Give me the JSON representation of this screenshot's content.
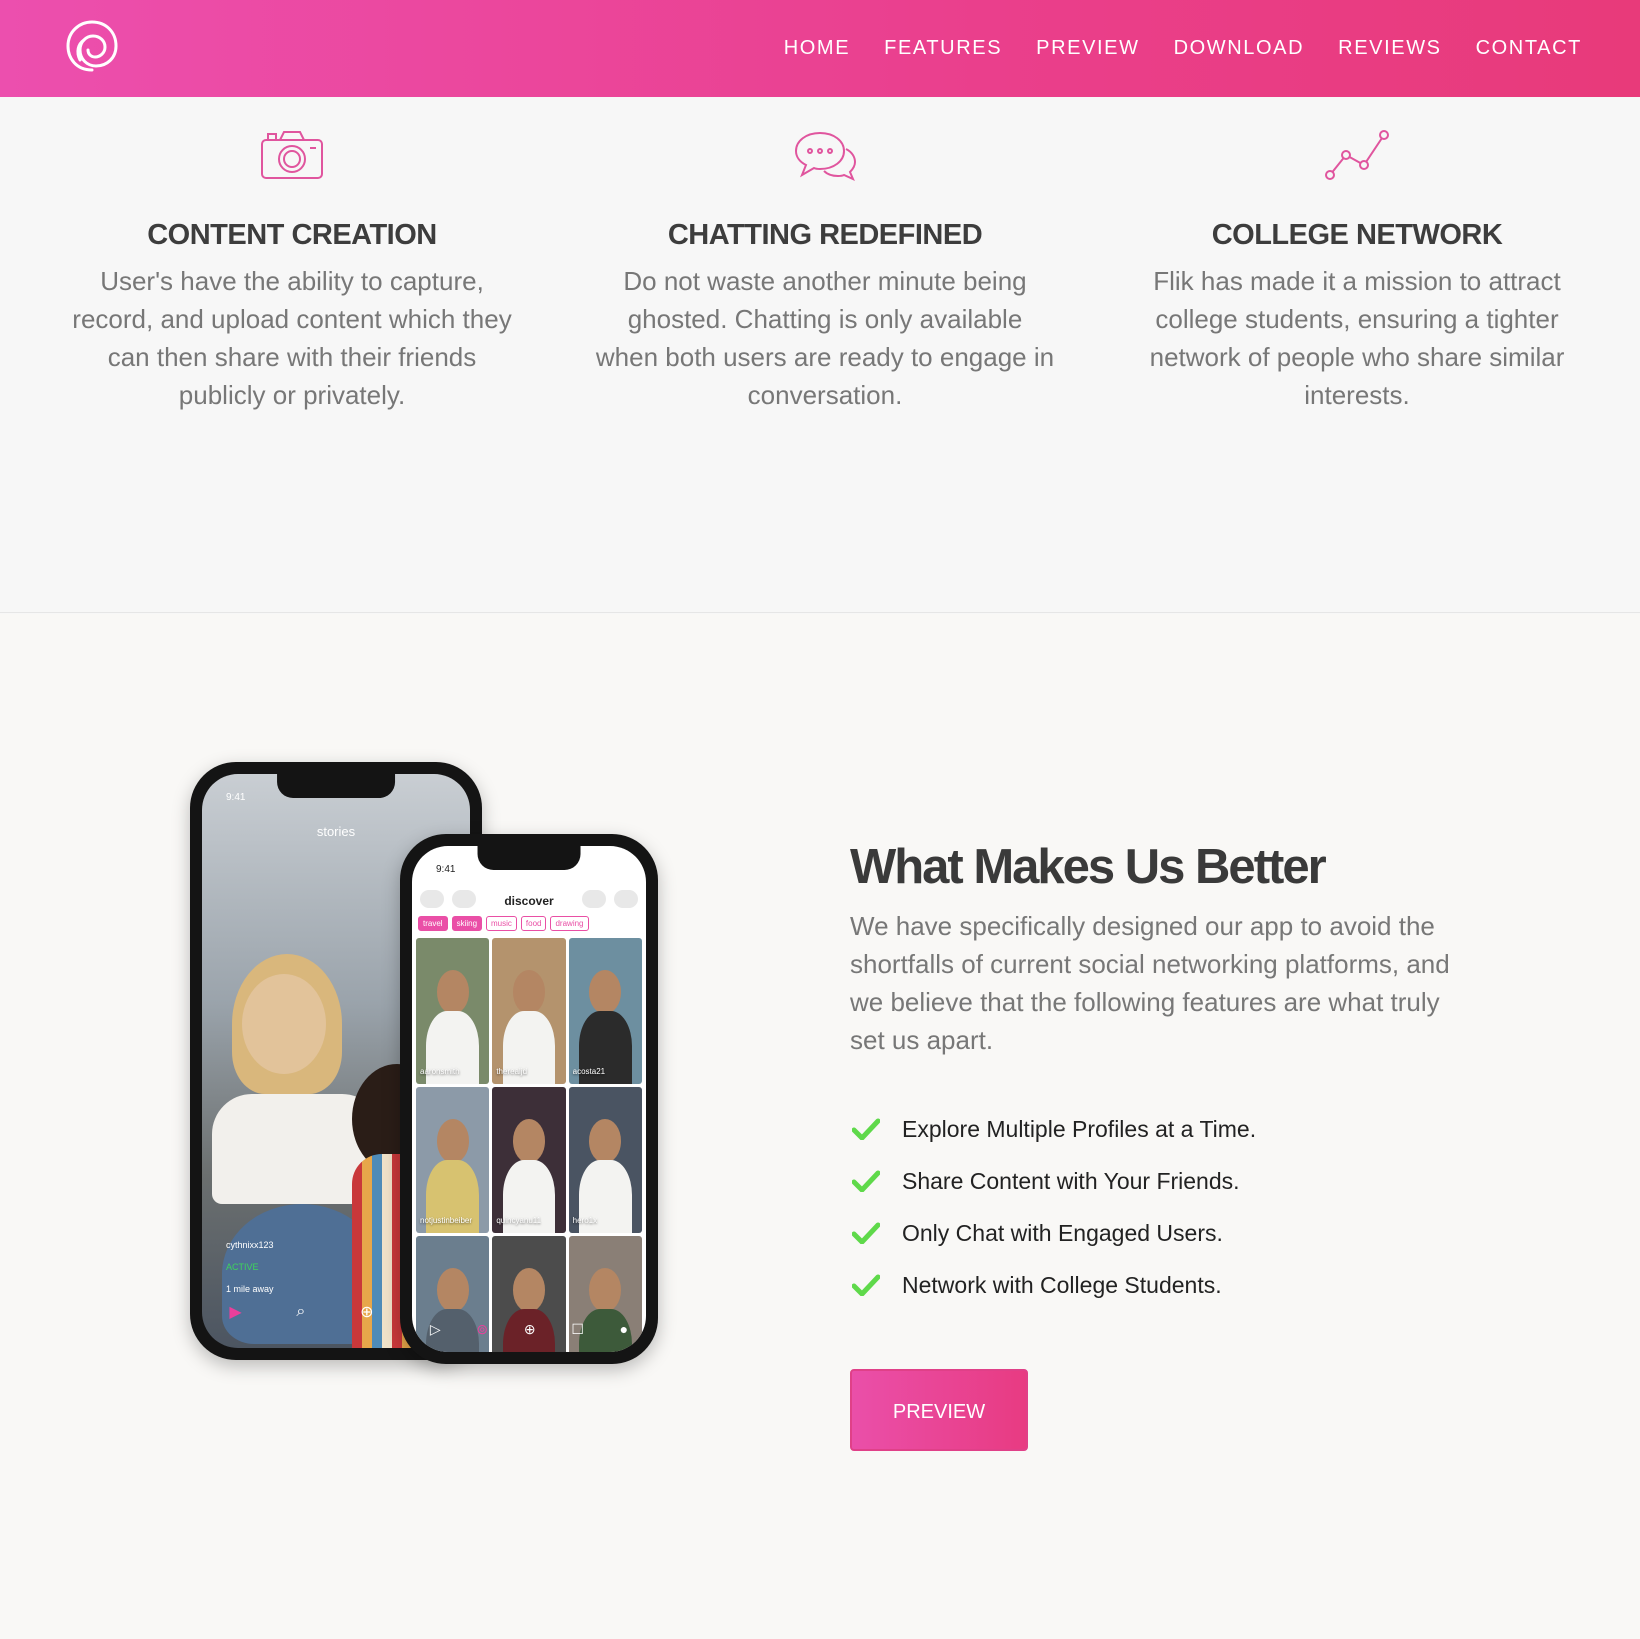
{
  "nav": {
    "logo_icon": "swirl-logo-icon",
    "links": [
      "HOME",
      "FEATURES",
      "PREVIEW",
      "DOWNLOAD",
      "REVIEWS",
      "CONTACT"
    ]
  },
  "features": [
    {
      "icon": "camera-icon",
      "title": "CONTENT CREATION",
      "text": "User's have the ability to capture, record, and upload content which they can then share with their friends publicly or privately."
    },
    {
      "icon": "chat-bubbles-icon",
      "title": "CHATTING REDEFINED",
      "text": "Do not waste another minute being ghosted. Chatting is only available when both users are ready to engage in conversation."
    },
    {
      "icon": "line-chart-icon",
      "title": "COLLEGE NETWORK",
      "text": "Flik has made it a mission to attract college students, ensuring a tighter network of people who share similar interests."
    }
  ],
  "phones": {
    "stories": {
      "time": "9:41",
      "title": "stories",
      "username": "cythnixx123",
      "status": "ACTIVE",
      "distance": "1 mile away"
    },
    "discover": {
      "time": "9:41",
      "title": "discover",
      "tags": [
        "travel",
        "skiing",
        "music",
        "food",
        "drawing"
      ],
      "tiles": [
        "aaronsmith",
        "therealjd",
        "acosta21",
        "notjustinbeiber",
        "quincyanu11",
        "hero1x",
        "",
        "",
        ""
      ]
    }
  },
  "better": {
    "title": "What Makes Us Better",
    "description": "We have specifically designed our app to avoid the shortfalls of current social networking platforms, and we believe that the following features are what truly set us apart.",
    "items": [
      "Explore Multiple Profiles at a Time.",
      "Share Content with Your Friends.",
      "Only Chat with Engaged Users.",
      "Network with College Students."
    ],
    "button_label": "PREVIEW"
  },
  "colors": {
    "brand_pink": "#ea4f9f",
    "check_green": "#5fd94a"
  }
}
